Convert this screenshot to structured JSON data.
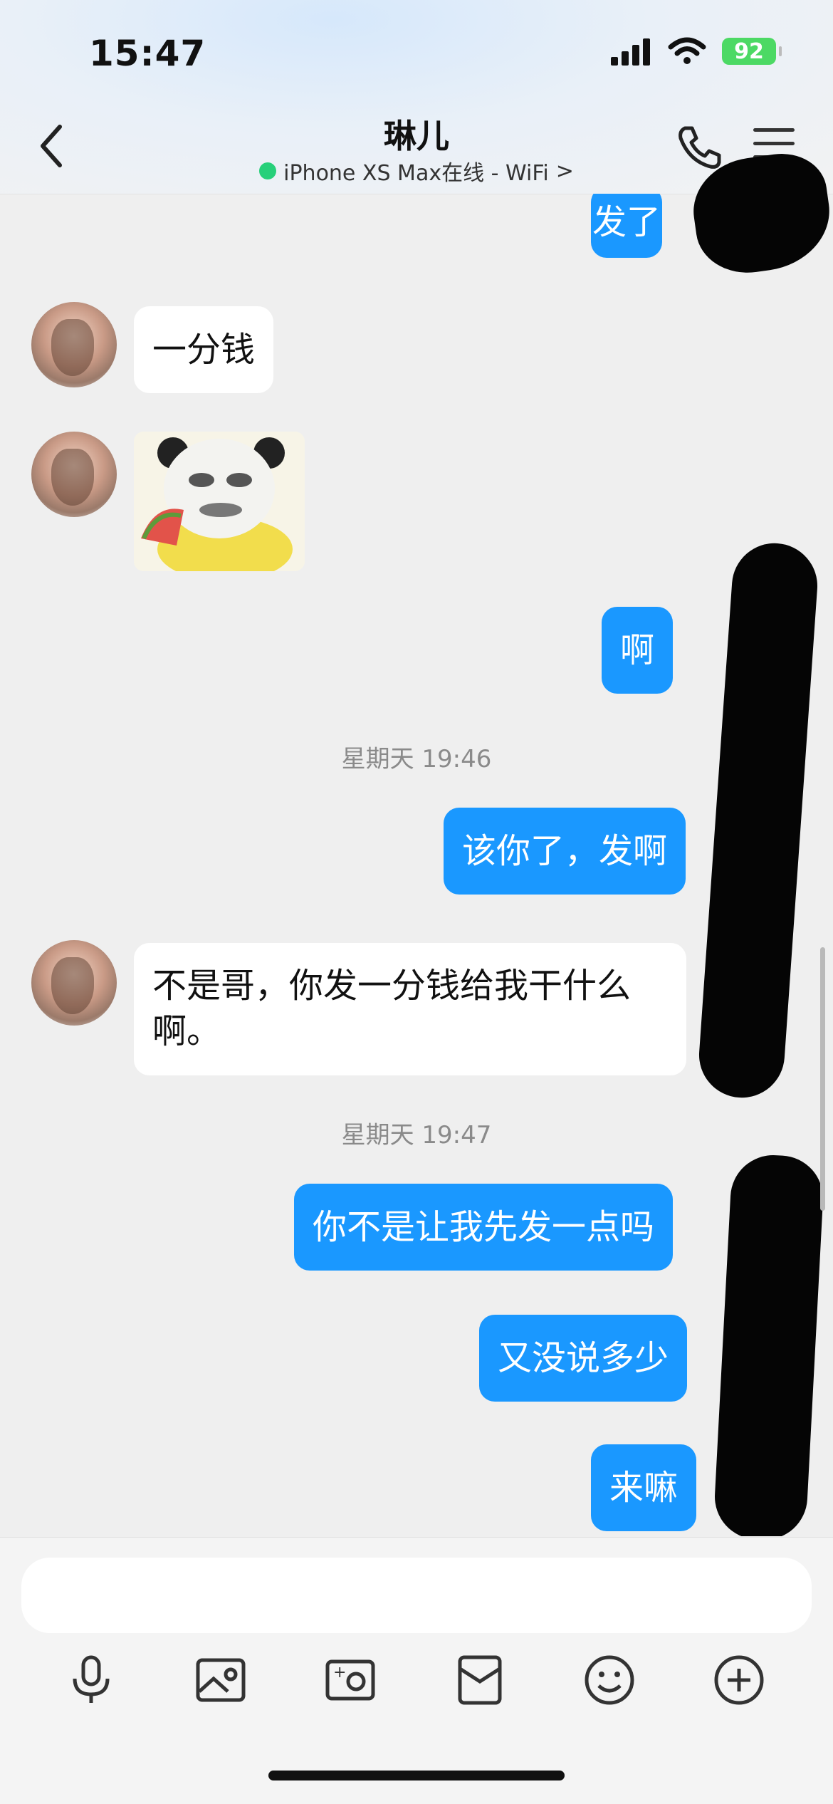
{
  "status_bar": {
    "time": "15:47",
    "battery": "92"
  },
  "header": {
    "title": "琳儿",
    "device_status": "iPhone XS Max在线 - WiFi",
    "chevron": ">"
  },
  "icons": {
    "back": "chevron-left-icon",
    "call": "phone-icon",
    "menu": "hamburger-menu-icon",
    "toolbar": [
      "microphone-icon",
      "image-icon",
      "camera-icon",
      "red-packet-icon",
      "emoji-icon",
      "plus-icon"
    ]
  },
  "messages": {
    "out_1": "发了",
    "in_1": "一分钱",
    "out_2": "啊",
    "time_1": "星期天 19:46",
    "out_3": "该你了，发啊",
    "in_2": "不是哥，你发一分钱给我干什么啊。",
    "time_2": "星期天 19:47",
    "out_4": "你不是让我先发一点吗",
    "out_5": "又没说多少",
    "out_6": "来嘛"
  },
  "composer": {
    "value": ""
  },
  "colors": {
    "outgoing_bubble": "#1a98ff",
    "incoming_bubble": "#ffffff",
    "background": "#efefef",
    "online": "#27d07a"
  }
}
